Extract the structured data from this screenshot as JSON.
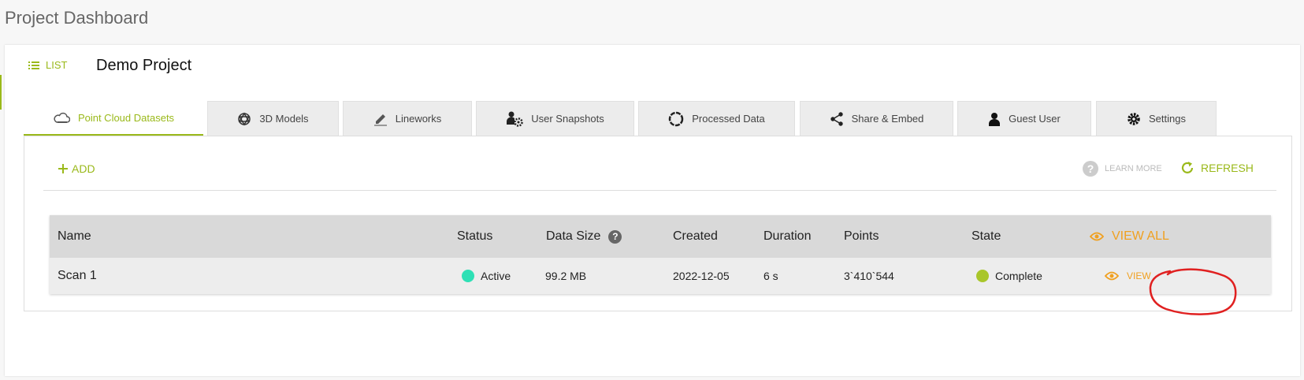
{
  "page": {
    "title": "Project Dashboard"
  },
  "header": {
    "list_label": "LIST",
    "project_name": "Demo Project"
  },
  "tabs": [
    {
      "label": "Point Cloud Datasets",
      "icon": "cloud-icon",
      "active": true
    },
    {
      "label": "3D Models",
      "icon": "mesh-icon"
    },
    {
      "label": "Lineworks",
      "icon": "pencil-icon"
    },
    {
      "label": "User Snapshots",
      "icon": "user-gear-icon"
    },
    {
      "label": "Processed Data",
      "icon": "circle-ring-icon"
    },
    {
      "label": "Share & Embed",
      "icon": "share-icon"
    },
    {
      "label": "Guest User",
      "icon": "user-icon"
    },
    {
      "label": "Settings",
      "icon": "gear-icon"
    }
  ],
  "toolbar": {
    "add_label": "ADD",
    "learn_more_label": "LEARN MORE",
    "refresh_label": "REFRESH"
  },
  "table": {
    "headers": {
      "name": "Name",
      "status": "Status",
      "data_size": "Data Size",
      "created": "Created",
      "duration": "Duration",
      "points": "Points",
      "state": "State",
      "view_all": "VIEW ALL"
    },
    "data_size_help": "?",
    "rows": [
      {
        "name": "Scan 1",
        "status": "Active",
        "data_size": "99.2 MB",
        "created": "2022-12-05",
        "duration": "6 s",
        "points": "3`410`544",
        "state": "Complete",
        "view": "VIEW"
      }
    ]
  },
  "colors": {
    "accent": "#9ab91a",
    "orange": "#f0a020",
    "active_dot": "#2ee0b5",
    "complete_dot": "#a9c62a",
    "annotation": "#e02020"
  }
}
